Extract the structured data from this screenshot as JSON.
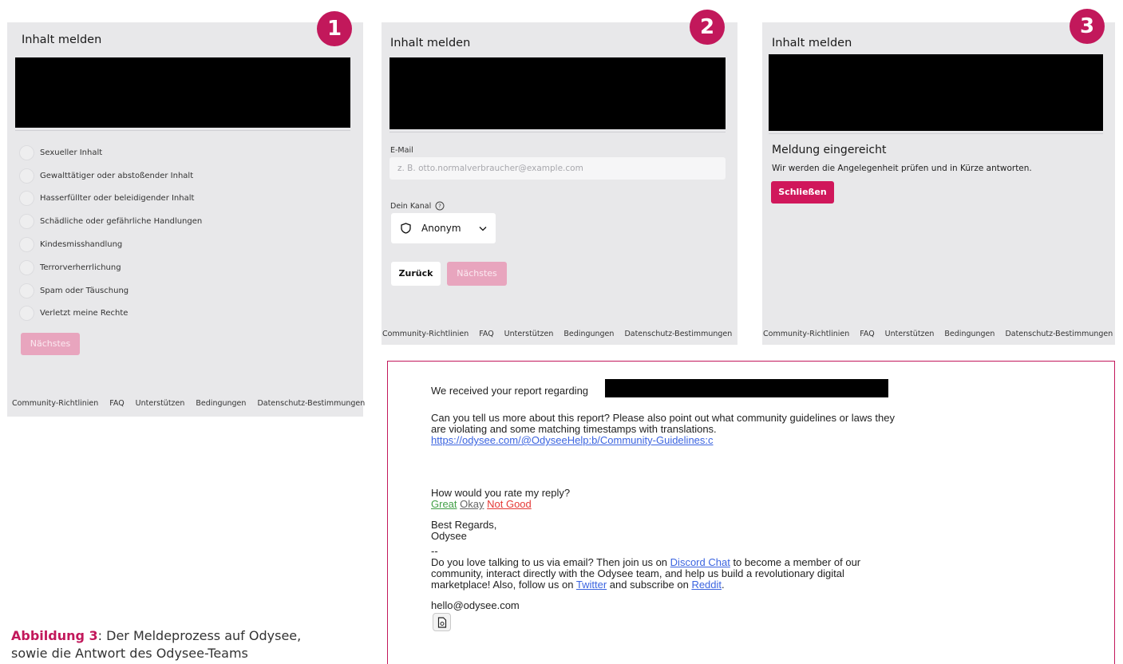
{
  "panel1": {
    "title": "Inhalt melden",
    "step": "1",
    "options": [
      "Sexueller Inhalt",
      "Gewalttätiger oder abstoßender Inhalt",
      "Hasserfüllter oder beleidigender Inhalt",
      "Schädliche oder gefährliche Handlungen",
      "Kindesmisshandlung",
      "Terrorverherrlichung",
      "Spam oder Täuschung",
      "Verletzt meine Rechte"
    ],
    "next_label": "Nächstes"
  },
  "panel2": {
    "title": "Inhalt melden",
    "step": "2",
    "email_label": "E-Mail",
    "email_placeholder": "z. B. otto.normalverbraucher@example.com",
    "channel_label": "Dein Kanal",
    "channel_value": "Anonym",
    "back_label": "Zurück",
    "next_label": "Nächstes"
  },
  "panel3": {
    "title": "Inhalt melden",
    "step": "3",
    "heading": "Meldung eingereicht",
    "message": "Wir werden die Angelegenheit prüfen und in Kürze antworten.",
    "close_label": "Schließen"
  },
  "footer": {
    "links": [
      "Community-Richtlinien",
      "FAQ",
      "Unterstützen",
      "Bedingungen",
      "Datenschutz-Bestimmungen"
    ]
  },
  "email": {
    "received": "We received your report regarding",
    "question_line1": "Can you tell us more about this report? Please also point out what community guidelines or laws they",
    "question_line2": "are violating and some matching timestamps with translations.",
    "guidelines_link": "https://odysee.com/@OdyseeHelp:b/Community-Guidelines:c",
    "rate_question": "How would you rate my reply?",
    "rate_great": "Great",
    "rate_okay": "Okay",
    "rate_notgood": "Not Good",
    "regards": "Best Regards,",
    "signature": "Odysee",
    "dashes": "--",
    "promo_a": "Do you love talking to us via email? Then join us on",
    "discord_link": "Discord Chat",
    "promo_b": "to become a member of our",
    "promo_line2": "community, interact directly with the Odysee team, and help us build a revolutionary digital",
    "promo_line3a": "marketplace! Also, follow us on",
    "twitter_link": "Twitter",
    "promo_line3b": "and subscribe on",
    "reddit_link": "Reddit",
    "address": "hello@odysee.com"
  },
  "caption": {
    "label": "Abbildung 3",
    "line1": ": Der Meldeprozess auf Odysee,",
    "line2": "sowie die Antwort des Odysee-Teams"
  },
  "colors": {
    "brand": "#c2185b",
    "button_primary": "#d0175b",
    "button_disabled": "#e8a5be",
    "panel_bg": "#e8e8ea",
    "link": "#3b64e0"
  }
}
